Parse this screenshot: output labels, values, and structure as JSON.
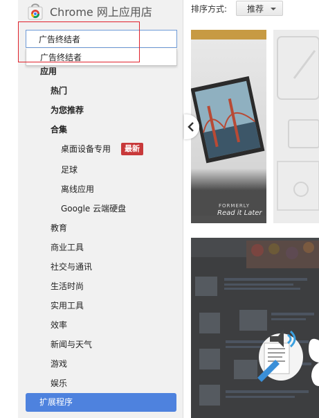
{
  "app": {
    "title": "Chrome 网上应用店"
  },
  "search": {
    "value": "广告终结者",
    "suggestion": "广告终结者"
  },
  "sidebar": {
    "items": [
      {
        "label": "应用",
        "bold": true
      },
      {
        "label": "热门",
        "bold": true
      },
      {
        "label": "为您推荐",
        "bold": true
      },
      {
        "label": "合集",
        "bold": true
      },
      {
        "label": "桌面设备专用"
      },
      {
        "label": "足球"
      },
      {
        "label": "离线应用"
      },
      {
        "label": "Google 云端硬盘"
      },
      {
        "label": "教育"
      },
      {
        "label": "商业工具"
      },
      {
        "label": "社交与通讯"
      },
      {
        "label": "生活时尚"
      },
      {
        "label": "实用工具"
      },
      {
        "label": "效率"
      },
      {
        "label": "新闻与天气"
      },
      {
        "label": "游戏"
      },
      {
        "label": "娱乐"
      }
    ],
    "badge_new": "最新",
    "extensions_label": "扩展程序"
  },
  "toolbar": {
    "sort_label": "排序方式:",
    "sort_value": "推荐"
  },
  "cards": {
    "readitlater": {
      "formerly": "FORMERLY",
      "logo_text": "Read it Later"
    }
  },
  "colors": {
    "accent": "#4e82de",
    "badge": "#c8393a",
    "highlight": "#e0202a"
  },
  "icons": {
    "logo": "chrome-web-store-bag-icon",
    "sort_caret": "caret-down-icon",
    "carousel_prev": "chevron-left-icon"
  }
}
